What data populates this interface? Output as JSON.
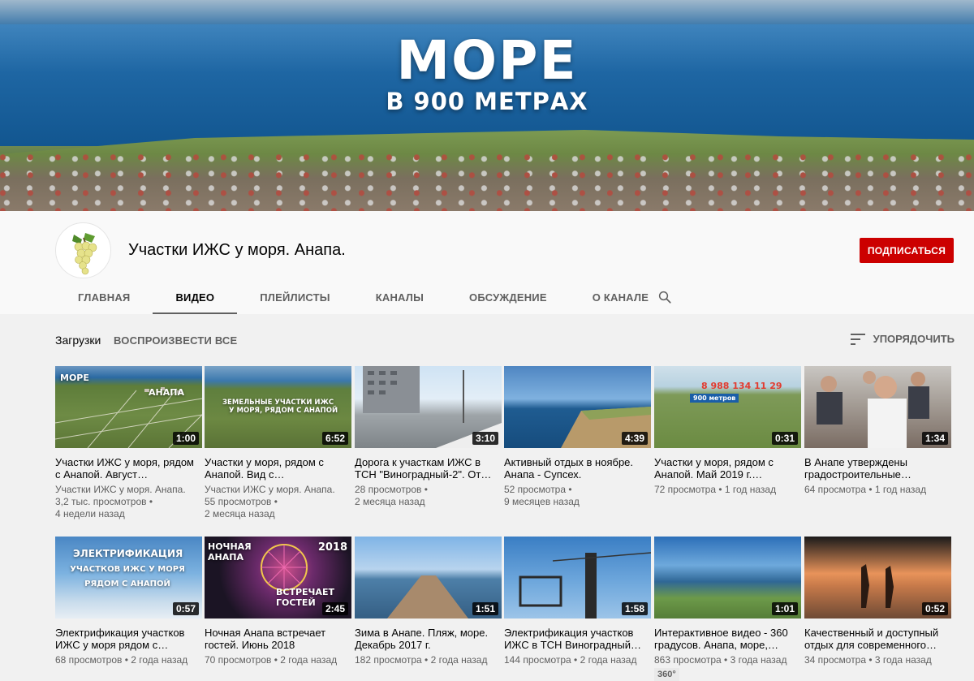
{
  "banner": {
    "title_line1": "МОРЕ",
    "title_line2": "В 900 МЕТРАХ"
  },
  "channel": {
    "name": "Участки ИЖС у моря. Анапа.",
    "subscribe_label": "ПОДПИСАТЬСЯ",
    "avatar_icon": "grapes-icon"
  },
  "tabs": [
    {
      "label": "ГЛАВНАЯ"
    },
    {
      "label": "ВИДЕО",
      "active": true
    },
    {
      "label": "ПЛЕЙЛИСТЫ"
    },
    {
      "label": "КАНАЛЫ"
    },
    {
      "label": "ОБСУЖДЕНИЕ"
    },
    {
      "label": "О КАНАЛЕ"
    }
  ],
  "section": {
    "uploads_label": "Загрузки",
    "play_all_label": "ВОСПРОИЗВЕСТИ ВСЕ",
    "sort_label": "УПОРЯДОЧИТЬ"
  },
  "videos": [
    {
      "duration": "1:00",
      "title": "Участки ИЖС у моря, рядом с Анапой. Август…",
      "meta1": "Участки ИЖС у моря. Анапа.",
      "meta2": "3,2 тыс. просмотров •",
      "meta3": "4 недели назад",
      "overlay_a": "МОРЕ",
      "overlay_b": "АНАПА"
    },
    {
      "duration": "6:52",
      "title": "Участки у моря, рядом с Анапой. Вид с…",
      "meta1": "Участки ИЖС у моря. Анапа.",
      "meta2": "55 просмотров •",
      "meta3": "2 месяца назад",
      "overlay_a": "ЗЕМЕЛЬНЫЕ УЧАСТКИ ИЖС",
      "overlay_b": "У МОРЯ, РЯДОМ С АНАПОЙ"
    },
    {
      "duration": "3:10",
      "title": "Дорога к участкам ИЖС в ТСН \"Виноградный-2\". От…",
      "meta1": "28 просмотров •",
      "meta2": "2 месяца назад",
      "meta3": ""
    },
    {
      "duration": "4:39",
      "title": "Активный отдых в ноябре. Анапа - Супсех.",
      "meta1": "52 просмотра •",
      "meta2": "9 месяцев назад",
      "meta3": ""
    },
    {
      "duration": "0:31",
      "title": "Участки у моря, рядом с Анапой. Май 2019 г.…",
      "meta1": "72 просмотра • 1 год назад",
      "meta2": "",
      "meta3": "",
      "overlay_a": "8 988 134 11 29",
      "overlay_b": "900 метров"
    },
    {
      "duration": "1:34",
      "title": "В Анапе утверждены градостроительные…",
      "meta1": "64 просмотра • 1 год назад",
      "meta2": "",
      "meta3": ""
    },
    {
      "duration": "0:57",
      "title": "Электрификация участков ИЖС у моря рядом с…",
      "meta1": "68 просмотров • 2 года назад",
      "meta2": "",
      "meta3": "",
      "overlay_a": "ЭЛЕКТРИФИКАЦИЯ",
      "overlay_b": "УЧАСТКОВ ИЖС У МОРЯ РЯДОМ С АНАПОЙ"
    },
    {
      "duration": "2:45",
      "title": "Ночная Анапа встречает гостей. Июнь 2018",
      "meta1": "70 просмотров • 2 года назад",
      "meta2": "",
      "meta3": "",
      "overlay_a": "НОЧНАЯ АНАПА",
      "overlay_b": "2018",
      "overlay_c": "ВСТРЕЧАЕТ ГОСТЕЙ"
    },
    {
      "duration": "1:51",
      "title": "Зима в Анапе. Пляж, море. Декабрь 2017 г.",
      "meta1": "182 просмотра • 2 года назад",
      "meta2": "",
      "meta3": ""
    },
    {
      "duration": "1:58",
      "title": "Электрификация участков ИЖС в ТСН Виноградный…",
      "meta1": "144 просмотра • 2 года назад",
      "meta2": "",
      "meta3": ""
    },
    {
      "duration": "1:01",
      "title": "Интерактивное видео - 360 градусов. Анапа, море,…",
      "meta1": "863 просмотра • 3 года назад",
      "meta2": "",
      "meta3": "",
      "badge": "360°"
    },
    {
      "duration": "0:52",
      "title": "Качественный и доступный отдых для современного…",
      "meta1": "34 просмотра • 3 года назад",
      "meta2": "",
      "meta3": ""
    }
  ],
  "colors": {
    "subscribe_red": "#cc0000",
    "page_bg": "#f1f1f1",
    "header_bg": "#f9f9f9"
  }
}
